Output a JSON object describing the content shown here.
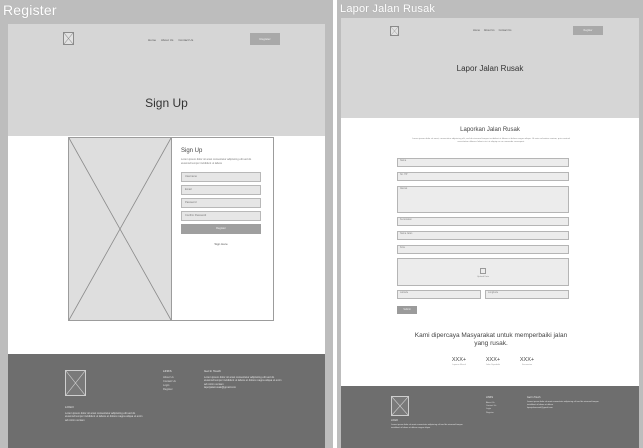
{
  "register": {
    "panel_title": "Register",
    "nav": {
      "links": [
        "Home",
        "About Us",
        "Contact Us"
      ],
      "button": "Register"
    },
    "hero_title": "Sign Up",
    "form": {
      "heading": "Sign Up",
      "description": "Lorem ipsum dolor sit amet consectetur adipiscing elit sed do eiusmod tempor incididunt ut labore",
      "fields": [
        "Username",
        "Email",
        "Password",
        "Confirm Password"
      ],
      "submit": "Register",
      "signin": "Sign Here"
    },
    "footer": {
      "brand": "LOGO",
      "about": "Lorem ipsum dolor sit amet consectetur adipiscing elit sed do eiusmod tempor incididunt ut labore et dolore magna aliqua ut enim ad minim veniam",
      "links_heading": "LINKS",
      "links": [
        "About Us",
        "Contact Us",
        "Login",
        "Register"
      ],
      "contact_heading": "Get In Touch",
      "contact": "Lorem ipsum dolor sit amet consectetur adipiscing elit sed do eiusmod tempor incididunt ut labore et dolore magna aliqua ut enim ad minim veniam",
      "email": "laporjalanrusak@gmail.com"
    }
  },
  "report": {
    "panel_title": "Lapor Jalan Rusak",
    "nav": {
      "links": [
        "Home",
        "About Us",
        "Contact Us"
      ],
      "button": "Register"
    },
    "hero_title": "Lapor Jalan Rusak",
    "form": {
      "title": "Laporkan Jalan Rusak",
      "description": "Lorem ipsum dolor sit amet, consectetur adipiscing elit, sed do eiusmod tempor incididunt ut labore et dolore magna aliqua. Ut enim ad minim veniam, quis nostrud exercitation ullamco laboris nisi ut aliquip ex ea commodo consequat.",
      "fields": [
        "Nama",
        "No. HP",
        "Alamat",
        "Kecamatan",
        "Nama Jalan",
        "Kota"
      ],
      "upload_label": "Upload Foto",
      "bottom_fields": [
        "Latitude",
        "Longitude"
      ],
      "submit": "Submit"
    },
    "trust_title": "Kami dipercaya Masyarakat untuk memperbaiki jalan yang rusak.",
    "stats": [
      {
        "value": "XXX+",
        "label": "Laporan Masuk"
      },
      {
        "value": "XXX+",
        "label": "Jalan Diperbaiki"
      },
      {
        "value": "XXX+",
        "label": "Kecamatan"
      }
    ],
    "footer": {
      "brand": "LOGO",
      "about": "Lorem ipsum dolor sit amet consectetur adipiscing elit sed do eiusmod tempor incididunt ut labore et dolore magna aliqua",
      "links_heading": "LINKS",
      "links": [
        "About Us",
        "Contact Us",
        "Login",
        "Register"
      ],
      "contact_heading": "Get In Touch",
      "contact": "Lorem ipsum dolor sit amet consectetur adipiscing elit sed do eiusmod tempor incididunt ut labore et dolore",
      "email": "laporjalanrusak@gmail.com"
    }
  }
}
